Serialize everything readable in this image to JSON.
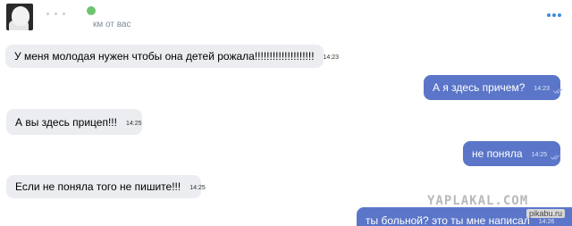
{
  "header": {
    "distance_label": "км от вас",
    "online_color": "#4bb34b",
    "more_icon": "more-horizontal-icon"
  },
  "messages": [
    {
      "direction": "in",
      "text": "У меня молодая нужен чтобы она детей рожала!!!!!!!!!!!!!!!!!!!!",
      "time": "14:23"
    },
    {
      "direction": "out",
      "text": "А я здесь причем?",
      "time": "14:23",
      "status": "read"
    },
    {
      "direction": "in",
      "text": "А вы здесь прицеп!!!",
      "time": "14:25"
    },
    {
      "direction": "out",
      "text": "не поняла",
      "time": "14:25",
      "status": "read"
    },
    {
      "direction": "in",
      "text": "Если не поняла того не пишите!!!",
      "time": "14:25"
    },
    {
      "direction": "out",
      "text": "ты больной? это ты мне написал",
      "time": "14:26"
    }
  ],
  "watermarks": {
    "yaplakal": "YAPLAKAL.COM",
    "pikabu": "pikabu.ru"
  },
  "colors": {
    "incoming_bubble": "#ebedf0",
    "outgoing_bubble": "#5b76c8",
    "accent": "#3f8ae0"
  }
}
